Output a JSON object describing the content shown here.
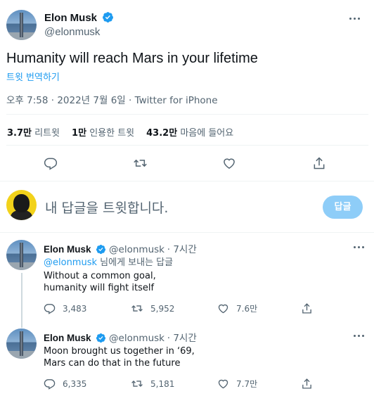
{
  "tweet": {
    "author_name": "Elon Musk",
    "author_handle": "@elonmusk",
    "text": "Humanity will reach Mars in your lifetime",
    "translate_label": "트윗 번역하기",
    "meta": "오후 7:58 · 2022년 7월 6일 · Twitter for iPhone",
    "stats": [
      {
        "value": "3.7만",
        "label": "리트윗"
      },
      {
        "value": "1만",
        "label": "인용한 트윗"
      },
      {
        "value": "43.2만",
        "label": "마음에 들어요"
      }
    ],
    "actions": [
      "reply-icon",
      "retweet-icon",
      "like-icon",
      "share-icon"
    ]
  },
  "composer": {
    "placeholder": "내 답글을 트윗합니다.",
    "button_label": "답글"
  },
  "replies": [
    {
      "author_name": "Elon Musk",
      "author_handle": "@elonmusk",
      "time": "· 7시간",
      "replying_to_link": "@elonmusk",
      "replying_to_suffix": " 님에게 보내는 답글",
      "lines": [
        "Without a common goal,",
        "humanity will fight itself"
      ],
      "reply_count": "3,483",
      "retweet_count": "5,952",
      "like_count": "7.6만"
    },
    {
      "author_name": "Elon Musk",
      "author_handle": "@elonmusk",
      "time": "· 7시간",
      "lines": [
        "Moon brought us together in ‘69,",
        "Mars can do that in the future"
      ],
      "reply_count": "6,335",
      "retweet_count": "5,181",
      "like_count": "7.7만"
    }
  ],
  "colors": {
    "accent": "#1d9bf0",
    "muted": "#536471",
    "divider": "#eff3f4",
    "button_disabled": "#8ecdf8"
  }
}
